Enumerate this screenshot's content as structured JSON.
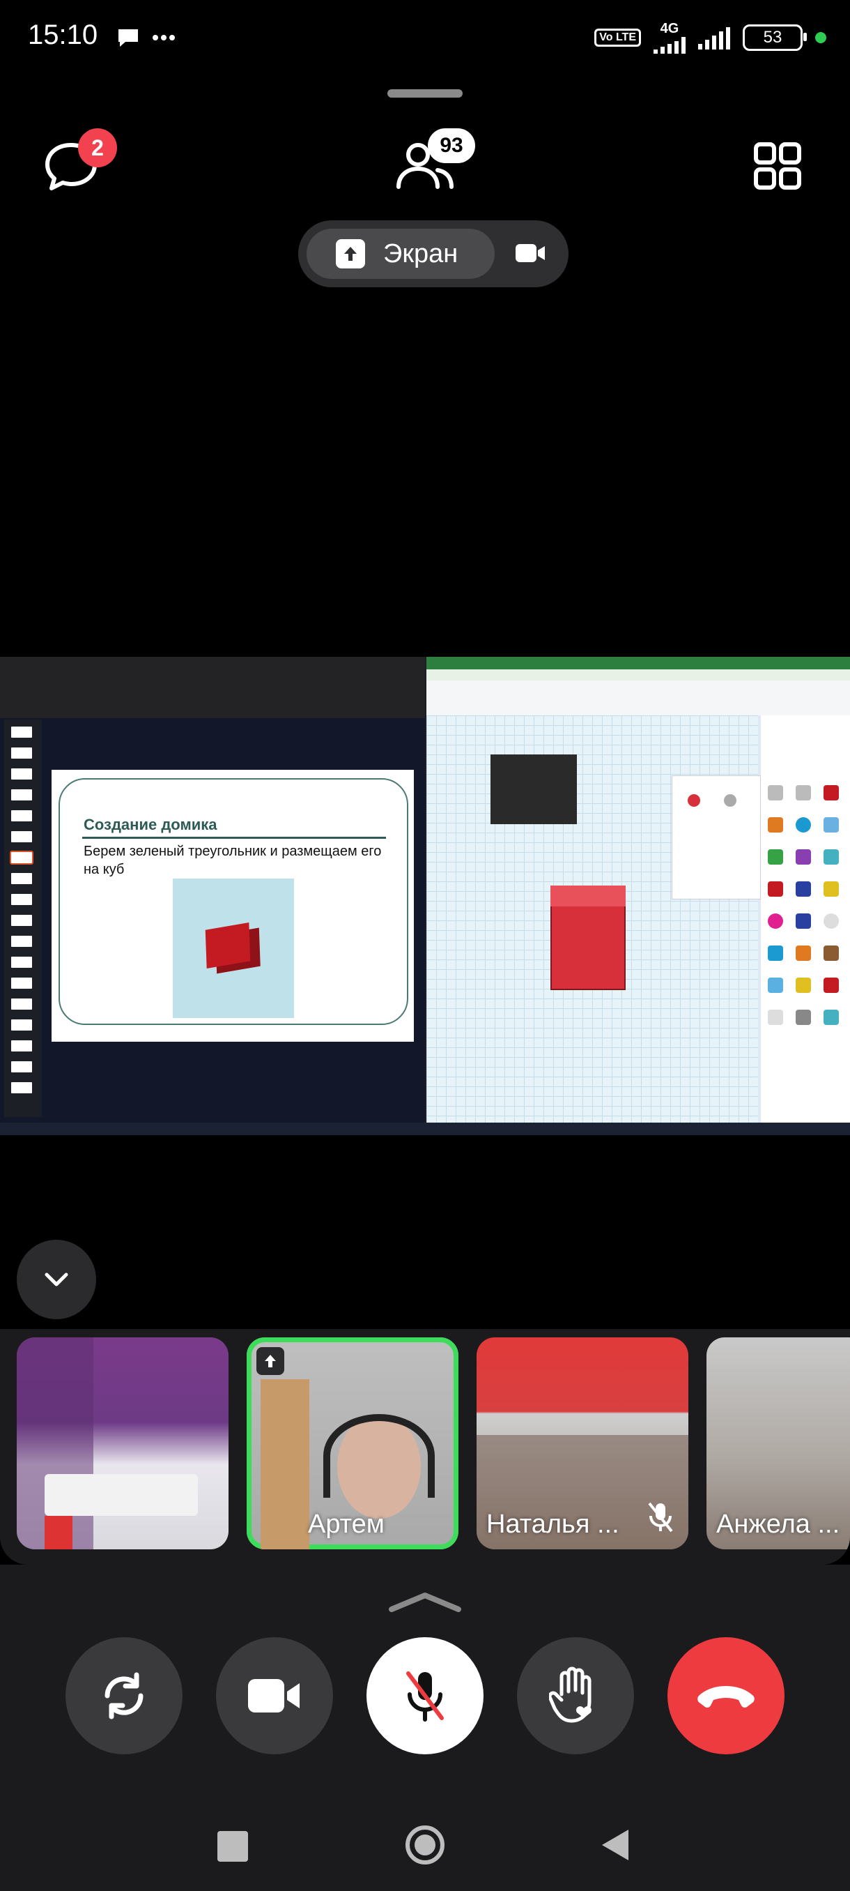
{
  "status_bar": {
    "time": "15:10",
    "volte_label": "Vo LTE",
    "network_label": "4G",
    "battery": "53"
  },
  "top_bar": {
    "chat_badge": "2",
    "participants_badge": "93"
  },
  "screen_share": {
    "share_label": "Экран"
  },
  "shared_content": {
    "slide_title": "Создание домика",
    "slide_text": "Берем зеленый треугольник и размещаем его на куб"
  },
  "participants": [
    {
      "name": ""
    },
    {
      "name": "Артем"
    },
    {
      "name": "Наталья ..."
    },
    {
      "name": "Анжела ..."
    }
  ],
  "colors": {
    "badge": "#f2414f",
    "active_speaker": "#3ddc5b",
    "end_call": "#ee3b3f"
  }
}
